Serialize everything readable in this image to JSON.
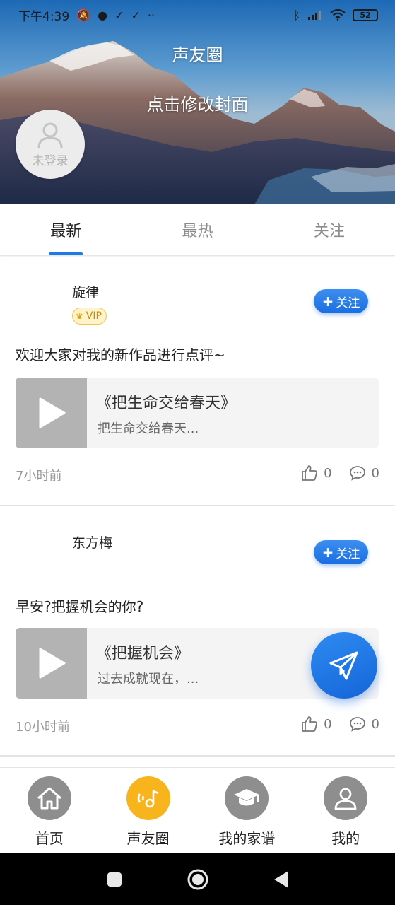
{
  "status_bar": {
    "time": "下午4:39",
    "battery": "52"
  },
  "cover": {
    "title": "声友圈",
    "edit_label": "点击修改封面",
    "login_label": "未登录"
  },
  "tabs": [
    {
      "label": "最新",
      "active": true
    },
    {
      "label": "最热",
      "active": false
    },
    {
      "label": "关注",
      "active": false
    }
  ],
  "posts": [
    {
      "author": "旋律",
      "vip_label": "VIP",
      "follow_label": "关注",
      "text": "欢迎大家对我的新作品进行点评~",
      "media_title": "《把生命交给春天》",
      "media_subtitle": "把生命交给春天...",
      "time": "7小时前",
      "likes": "0",
      "comments": "0"
    },
    {
      "author": "东方梅",
      "follow_label": "关注",
      "text": "早安?把握机会的你?",
      "media_title": "《把握机会》",
      "media_subtitle": "过去成就现在，...",
      "time": "10小时前",
      "likes": "0",
      "comments": "0"
    }
  ],
  "bottom_nav": [
    {
      "label": "首页",
      "icon": "home-icon",
      "active": false
    },
    {
      "label": "声友圈",
      "icon": "music-circle-icon",
      "active": true
    },
    {
      "label": "我的家谱",
      "icon": "graduation-cap-icon",
      "active": false
    },
    {
      "label": "我的",
      "icon": "user-icon",
      "active": false
    }
  ],
  "colors": {
    "accent": "#1e7be6",
    "active_nav": "#f7b41d",
    "vip_border": "#f2c44d"
  }
}
